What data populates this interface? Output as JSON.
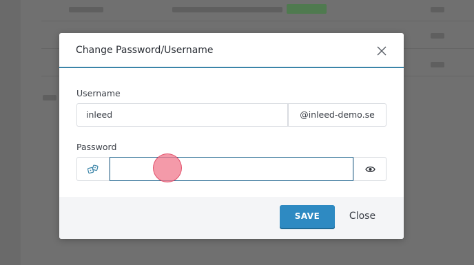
{
  "modal": {
    "title": "Change Password/Username",
    "username_label": "Username",
    "username_value": "inleed",
    "domain_suffix": "@inleed-demo.se",
    "password_label": "Password",
    "password_value": "",
    "save_label": "SAVE",
    "close_label": "Close"
  },
  "icons": {
    "close": "close-icon",
    "generate": "dice-icon",
    "show_password": "eye-icon"
  },
  "colors": {
    "accent": "#3a84a8",
    "save_button": "#2e8ac2",
    "input_focus_border": "#2c6e95"
  }
}
